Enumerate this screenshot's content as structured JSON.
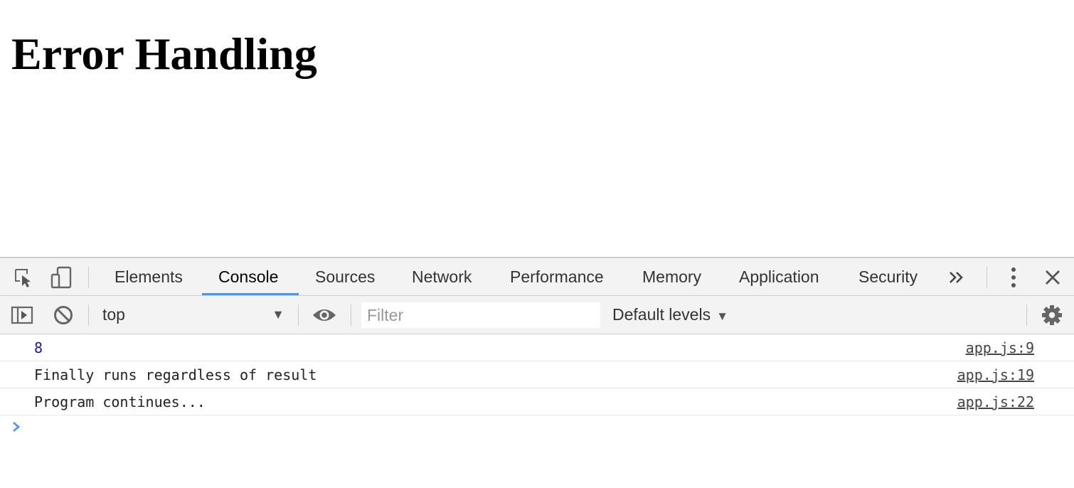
{
  "page": {
    "heading": "Error Handling"
  },
  "devtools": {
    "tabs": [
      {
        "label": "Elements"
      },
      {
        "label": "Console",
        "active": true
      },
      {
        "label": "Sources"
      },
      {
        "label": "Network"
      },
      {
        "label": "Performance"
      },
      {
        "label": "Memory"
      },
      {
        "label": "Application"
      },
      {
        "label": "Security"
      }
    ],
    "icons": {
      "inspect": "inspect-element-icon",
      "device": "device-toolbar-icon",
      "more_tabs": "more-tabs-icon",
      "menu": "kebab-menu-icon",
      "close": "close-icon",
      "sidebar": "sidebar-toggle-icon",
      "clear": "clear-console-icon",
      "eye": "live-expression-eye-icon",
      "settings": "gear-icon"
    },
    "accent_color": "#4f95e6"
  },
  "console": {
    "context": "top",
    "filter": {
      "value": "",
      "placeholder": "Filter"
    },
    "levels_label": "Default levels",
    "messages": [
      {
        "text": "8",
        "kind": "number",
        "source": "app.js:9"
      },
      {
        "text": "Finally runs regardless of result",
        "kind": "string",
        "source": "app.js:19"
      },
      {
        "text": "Program continues...",
        "kind": "string",
        "source": "app.js:22"
      }
    ],
    "prompt_color": "#4f95e6"
  }
}
